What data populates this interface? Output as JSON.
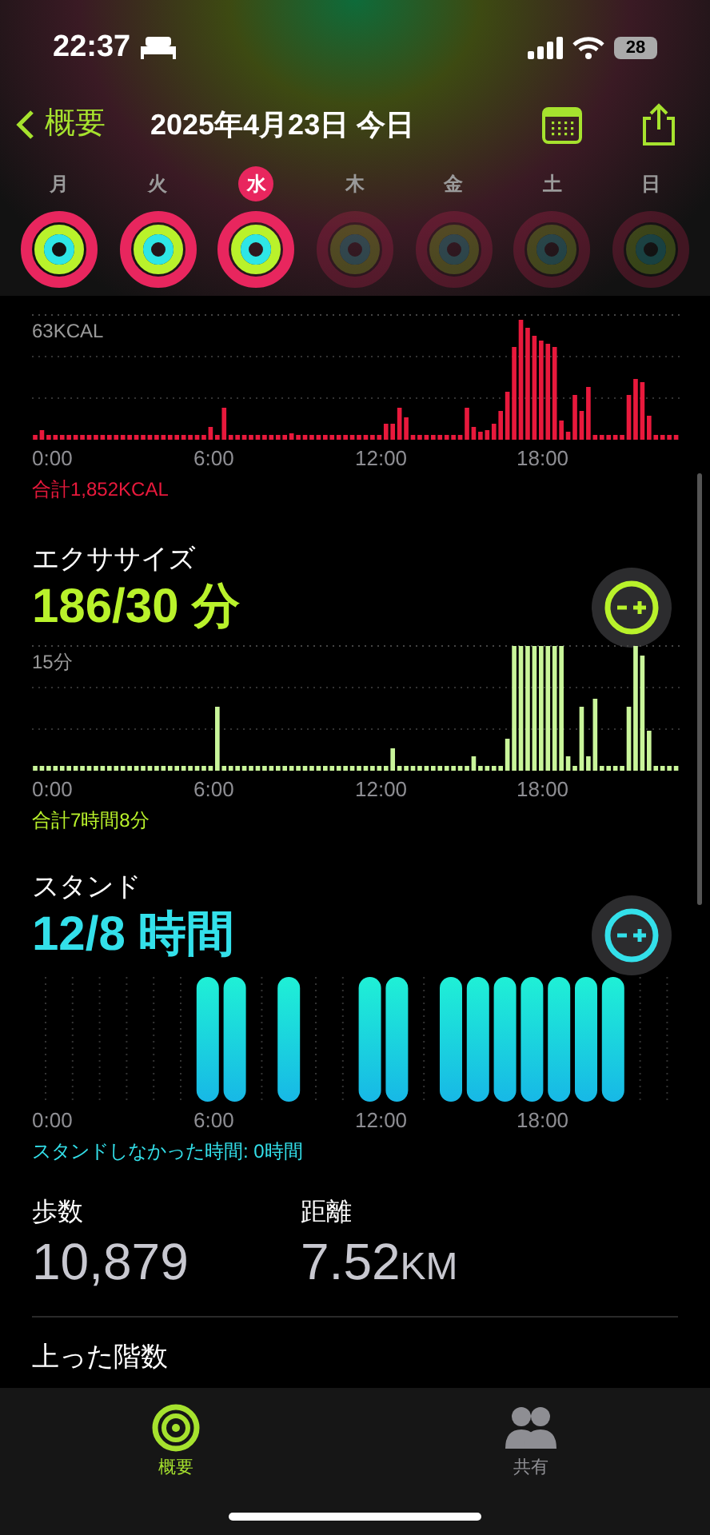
{
  "status_bar": {
    "time": "22:37",
    "battery": "28"
  },
  "nav": {
    "back": "概要",
    "title": "2025年4月23日 今日"
  },
  "week": [
    {
      "label": "月",
      "selected": false,
      "future": false
    },
    {
      "label": "火",
      "selected": false,
      "future": false
    },
    {
      "label": "水",
      "selected": true,
      "future": false
    },
    {
      "label": "木",
      "selected": false,
      "future": true
    },
    {
      "label": "金",
      "selected": false,
      "future": true
    },
    {
      "label": "土",
      "selected": false,
      "future": true
    },
    {
      "label": "日",
      "selected": false,
      "future": true
    }
  ],
  "move": {
    "max_label": "63KCAL",
    "x_labels": [
      "0:00",
      "6:00",
      "12:00",
      "18:00"
    ],
    "total": "合計1,852KCAL"
  },
  "exercise": {
    "title": "エクササイズ",
    "value": "186/30 分",
    "max_label": "15分",
    "x_labels": [
      "0:00",
      "6:00",
      "12:00",
      "18:00"
    ],
    "total": "合計7時間8分"
  },
  "stand": {
    "title": "スタンド",
    "value": "12/8 時間",
    "x_labels": [
      "0:00",
      "6:00",
      "12:00",
      "18:00"
    ],
    "total": "スタンドしなかった時間: 0時間"
  },
  "stats": [
    {
      "label": "歩数",
      "value": "10,879"
    },
    {
      "label": "距離",
      "value": "7.52",
      "unit": "KM"
    }
  ],
  "next_section": {
    "title": "上った階数"
  },
  "tab_bar": [
    {
      "label": "概要",
      "selected": true
    },
    {
      "label": "共有",
      "selected": false
    }
  ]
}
